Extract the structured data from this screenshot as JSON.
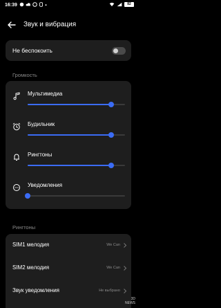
{
  "status_bar": {
    "time": "16:39",
    "battery": "82"
  },
  "header": {
    "title": "Звук и вибрация"
  },
  "dnd": {
    "label": "Не беспокоить",
    "enabled": false
  },
  "volume_section": {
    "title": "Громкость",
    "items": [
      {
        "label": "Мультимедиа",
        "icon": "music-note-icon",
        "level": 0.86
      },
      {
        "label": "Будильник",
        "icon": "alarm-clock-icon",
        "level": 0.86
      },
      {
        "label": "Рингтоны",
        "icon": "bell-icon",
        "level": 0.86
      },
      {
        "label": "Уведомления",
        "icon": "chat-bubble-icon",
        "level": 0.0
      }
    ]
  },
  "ringtones_section": {
    "title": "Рингтоны",
    "items": [
      {
        "label": "SIM1 мелодия",
        "value": "We Can"
      },
      {
        "label": "SIM2 мелодия",
        "value": "We Can"
      },
      {
        "label": "Звук уведомления",
        "value": "Не выбрано"
      }
    ]
  },
  "watermark": {
    "line1": "3D",
    "line2": "NEWS"
  },
  "colors": {
    "accent": "#3b6cf5",
    "card": "#1e1e1e",
    "background": "#000000"
  }
}
